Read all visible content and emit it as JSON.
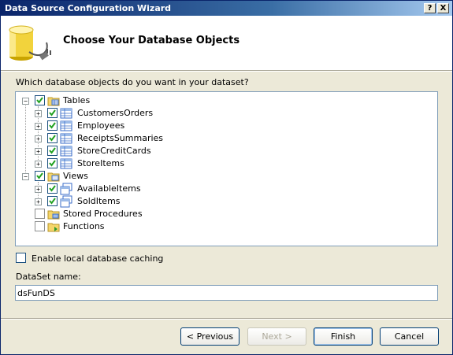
{
  "window": {
    "title": "Data Source Configuration Wizard",
    "help_label": "?",
    "close_label": "X"
  },
  "header": {
    "title": "Choose Your Database Objects",
    "icon": "database-plug-icon"
  },
  "question": "Which database objects do you want in your dataset?",
  "tree": {
    "tables": {
      "label": "Tables",
      "checked": true,
      "items": [
        {
          "label": "CustomersOrders",
          "checked": true
        },
        {
          "label": "Employees",
          "checked": true
        },
        {
          "label": "ReceiptsSummaries",
          "checked": true
        },
        {
          "label": "StoreCreditCards",
          "checked": true
        },
        {
          "label": "StoreItems",
          "checked": true
        }
      ]
    },
    "views": {
      "label": "Views",
      "checked": true,
      "items": [
        {
          "label": "AvailableItems",
          "checked": true
        },
        {
          "label": "SoldItems",
          "checked": true
        }
      ]
    },
    "stored_procedures": {
      "label": "Stored Procedures",
      "checked": false
    },
    "functions": {
      "label": "Functions",
      "checked": false
    }
  },
  "cache": {
    "label": "Enable local database caching",
    "checked": false
  },
  "dataset": {
    "label": "DataSet name:",
    "value": "dsFunDS"
  },
  "buttons": {
    "previous": "< Previous",
    "next": "Next >",
    "finish": "Finish",
    "cancel": "Cancel"
  },
  "colors": {
    "title_bar": "#0a246a",
    "dialog_bg": "#ece9d8",
    "check": "#21a121"
  }
}
